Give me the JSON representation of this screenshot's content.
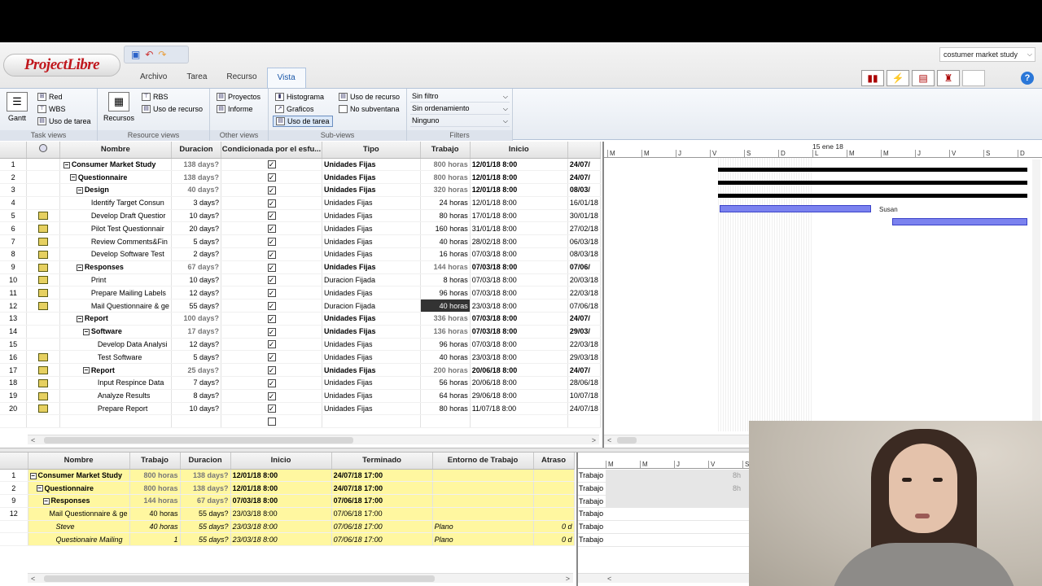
{
  "app": {
    "logo": "ProjectLibre",
    "project_select": "costumer market study",
    "tabs": [
      "Archivo",
      "Tarea",
      "Recurso",
      "Vista"
    ],
    "active_tab": "Vista"
  },
  "ribbon": {
    "task_views": {
      "label": "Task views",
      "gantt": "Gantt",
      "red": "Red",
      "wbs": "WBS",
      "uso_tarea": "Uso de tarea"
    },
    "resource_views": {
      "label": "Resource views",
      "recursos": "Recursos",
      "rbs": "RBS",
      "uso_recurso": "Uso de recurso"
    },
    "other_views": {
      "label": "Other views",
      "proyectos": "Proyectos",
      "informe": "Informe"
    },
    "sub_views": {
      "label": "Sub-views",
      "histograma": "Histograma",
      "graficos": "Graficos",
      "uso_tarea": "Uso de tarea",
      "uso_recurso": "Uso de recurso",
      "no_subventana": "No subventana"
    },
    "filters": {
      "label": "Filters",
      "filtro": "Sin filtro",
      "orden": "Sin ordenamiento",
      "grupo": "Ninguno"
    }
  },
  "main_table": {
    "headers": [
      "Nombre",
      "Duracion",
      "Condicionada por el esfu...",
      "Tipo",
      "Trabajo",
      "Inicio"
    ],
    "rows": [
      {
        "n": "1",
        "ind": false,
        "lvl": 0,
        "tg": "−",
        "name": "Consumer Market Study",
        "dur": "138 days?",
        "tipo": "Unidades Fijas",
        "trab": "800 horas",
        "ini": "12/01/18 8:00",
        "fin": "24/07/",
        "bold": true
      },
      {
        "n": "2",
        "ind": false,
        "lvl": 1,
        "tg": "−",
        "name": "Questionnaire",
        "dur": "138 days?",
        "tipo": "Unidades Fijas",
        "trab": "800 horas",
        "ini": "12/01/18 8:00",
        "fin": "24/07/",
        "bold": true
      },
      {
        "n": "3",
        "ind": false,
        "lvl": 2,
        "tg": "−",
        "name": "Design",
        "dur": "40 days?",
        "tipo": "Unidades Fijas",
        "trab": "320 horas",
        "ini": "12/01/18 8:00",
        "fin": "08/03/",
        "bold": true
      },
      {
        "n": "4",
        "ind": false,
        "lvl": 3,
        "tg": "",
        "name": "Identify Target Consun",
        "dur": "3 days?",
        "tipo": "Unidades Fijas",
        "trab": "24 horas",
        "ini": "12/01/18 8:00",
        "fin": "16/01/18",
        "bold": false
      },
      {
        "n": "5",
        "ind": true,
        "lvl": 3,
        "tg": "",
        "name": "Develop Draft Questior",
        "dur": "10 days?",
        "tipo": "Unidades Fijas",
        "trab": "80 horas",
        "ini": "17/01/18 8:00",
        "fin": "30/01/18",
        "bold": false
      },
      {
        "n": "6",
        "ind": true,
        "lvl": 3,
        "tg": "",
        "name": "Pilot Test Questionnair",
        "dur": "20 days?",
        "tipo": "Unidades Fijas",
        "trab": "160 horas",
        "ini": "31/01/18 8:00",
        "fin": "27/02/18",
        "bold": false
      },
      {
        "n": "7",
        "ind": true,
        "lvl": 3,
        "tg": "",
        "name": "Review Comments&Fin",
        "dur": "5 days?",
        "tipo": "Unidades Fijas",
        "trab": "40 horas",
        "ini": "28/02/18 8:00",
        "fin": "06/03/18",
        "bold": false
      },
      {
        "n": "8",
        "ind": true,
        "lvl": 3,
        "tg": "",
        "name": "Develop Software Test",
        "dur": "2 days?",
        "tipo": "Unidades Fijas",
        "trab": "16 horas",
        "ini": "07/03/18 8:00",
        "fin": "08/03/18",
        "bold": false
      },
      {
        "n": "9",
        "ind": true,
        "lvl": 2,
        "tg": "−",
        "name": "Responses",
        "dur": "67 days?",
        "tipo": "Unidades Fijas",
        "trab": "144 horas",
        "ini": "07/03/18 8:00",
        "fin": "07/06/",
        "bold": true
      },
      {
        "n": "10",
        "ind": true,
        "lvl": 3,
        "tg": "",
        "name": "Print",
        "dur": "10 days?",
        "tipo": "Duracion Fijada",
        "trab": "8 horas",
        "ini": "07/03/18 8:00",
        "fin": "20/03/18",
        "bold": false
      },
      {
        "n": "11",
        "ind": true,
        "lvl": 3,
        "tg": "",
        "name": "Prepare Mailing Labels",
        "dur": "12 days?",
        "tipo": "Unidades Fijas",
        "trab": "96 horas",
        "ini": "07/03/18 8:00",
        "fin": "22/03/18",
        "bold": false
      },
      {
        "n": "12",
        "ind": true,
        "lvl": 3,
        "tg": "",
        "name": "Mail Questionnaire & ge",
        "dur": "55 days?",
        "tipo": "Duracion Fijada",
        "trab": "40 horas",
        "ini": "23/03/18 8:00",
        "fin": "07/06/18",
        "bold": false,
        "hl": true
      },
      {
        "n": "13",
        "ind": false,
        "lvl": 2,
        "tg": "−",
        "name": "Report",
        "dur": "100 days?",
        "tipo": "Unidades Fijas",
        "trab": "336 horas",
        "ini": "07/03/18 8:00",
        "fin": "24/07/",
        "bold": true
      },
      {
        "n": "14",
        "ind": false,
        "lvl": 3,
        "tg": "−",
        "name": "Software",
        "dur": "17 days?",
        "tipo": "Unidades Fijas",
        "trab": "136 horas",
        "ini": "07/03/18 8:00",
        "fin": "29/03/",
        "bold": true
      },
      {
        "n": "15",
        "ind": false,
        "lvl": 4,
        "tg": "",
        "name": "Develop Data Analysi",
        "dur": "12 days?",
        "tipo": "Unidades Fijas",
        "trab": "96 horas",
        "ini": "07/03/18 8:00",
        "fin": "22/03/18",
        "bold": false
      },
      {
        "n": "16",
        "ind": true,
        "lvl": 4,
        "tg": "",
        "name": "Test Software",
        "dur": "5 days?",
        "tipo": "Unidades Fijas",
        "trab": "40 horas",
        "ini": "23/03/18 8:00",
        "fin": "29/03/18",
        "bold": false
      },
      {
        "n": "17",
        "ind": true,
        "lvl": 3,
        "tg": "−",
        "name": "Report",
        "dur": "25 days?",
        "tipo": "Unidades Fijas",
        "trab": "200 horas",
        "ini": "20/06/18 8:00",
        "fin": "24/07/",
        "bold": true
      },
      {
        "n": "18",
        "ind": true,
        "lvl": 4,
        "tg": "",
        "name": "Input Respince Data",
        "dur": "7 days?",
        "tipo": "Unidades Fijas",
        "trab": "56 horas",
        "ini": "20/06/18 8:00",
        "fin": "28/06/18",
        "bold": false
      },
      {
        "n": "19",
        "ind": true,
        "lvl": 4,
        "tg": "",
        "name": "Analyze Results",
        "dur": "8 days?",
        "tipo": "Unidades Fijas",
        "trab": "64 horas",
        "ini": "29/06/18 8:00",
        "fin": "10/07/18",
        "bold": false
      },
      {
        "n": "20",
        "ind": true,
        "lvl": 4,
        "tg": "",
        "name": "Prepare Report",
        "dur": "10 days?",
        "tipo": "Unidades Fijas",
        "trab": "80 horas",
        "ini": "11/07/18 8:00",
        "fin": "24/07/18",
        "bold": false
      }
    ]
  },
  "gantt": {
    "week_label": "15 ene 18",
    "days": [
      "M",
      "M",
      "J",
      "V",
      "S",
      "D",
      "L",
      "M",
      "M",
      "J",
      "V",
      "S",
      "D"
    ],
    "resource_label": "Susan"
  },
  "bottom_table": {
    "headers": [
      "Nombre",
      "Trabajo",
      "Duracion",
      "Inicio",
      "Terminado",
      "Entorno de Trabajo",
      "Atraso"
    ],
    "rows": [
      {
        "n": "1",
        "tg": "−",
        "lvl": 0,
        "name": "Consumer Market Study",
        "trab": "800 horas",
        "dur": "138 days?",
        "ini": "12/01/18 8:00",
        "fin": "24/07/18 17:00",
        "env": "",
        "atr": "",
        "bold": true,
        "ital": false
      },
      {
        "n": "2",
        "tg": "−",
        "lvl": 1,
        "name": "Questionnaire",
        "trab": "800 horas",
        "dur": "138 days?",
        "ini": "12/01/18 8:00",
        "fin": "24/07/18 17:00",
        "env": "",
        "atr": "",
        "bold": true,
        "ital": false
      },
      {
        "n": "9",
        "tg": "−",
        "lvl": 2,
        "name": "Responses",
        "trab": "144 horas",
        "dur": "67 days?",
        "ini": "07/03/18 8:00",
        "fin": "07/06/18 17:00",
        "env": "",
        "atr": "",
        "bold": true,
        "ital": false
      },
      {
        "n": "12",
        "tg": "",
        "lvl": 3,
        "name": "Mail Questionnaire & ge",
        "trab": "40 horas",
        "dur": "55 days?",
        "ini": "23/03/18 8:00",
        "fin": "07/06/18 17:00",
        "env": "",
        "atr": "",
        "bold": false,
        "ital": false
      },
      {
        "n": "",
        "tg": "",
        "lvl": 4,
        "name": "Steve",
        "trab": "40 horas",
        "dur": "55 days?",
        "ini": "23/03/18 8:00",
        "fin": "07/06/18 17:00",
        "env": "Plano",
        "atr": "0 d",
        "bold": false,
        "ital": true
      },
      {
        "n": "",
        "tg": "",
        "lvl": 4,
        "name": "Questionaire Mailing",
        "trab": "1",
        "dur": "55 days?",
        "ini": "23/03/18 8:00",
        "fin": "07/06/18 17:00",
        "env": "Plano",
        "atr": "0 d",
        "bold": false,
        "ital": true
      }
    ]
  },
  "bottom_gantt": {
    "days": [
      "M",
      "M",
      "J",
      "V",
      "S"
    ],
    "row_label": "Trabajo",
    "values": [
      "8h",
      "8h",
      "",
      "",
      "",
      ""
    ]
  }
}
